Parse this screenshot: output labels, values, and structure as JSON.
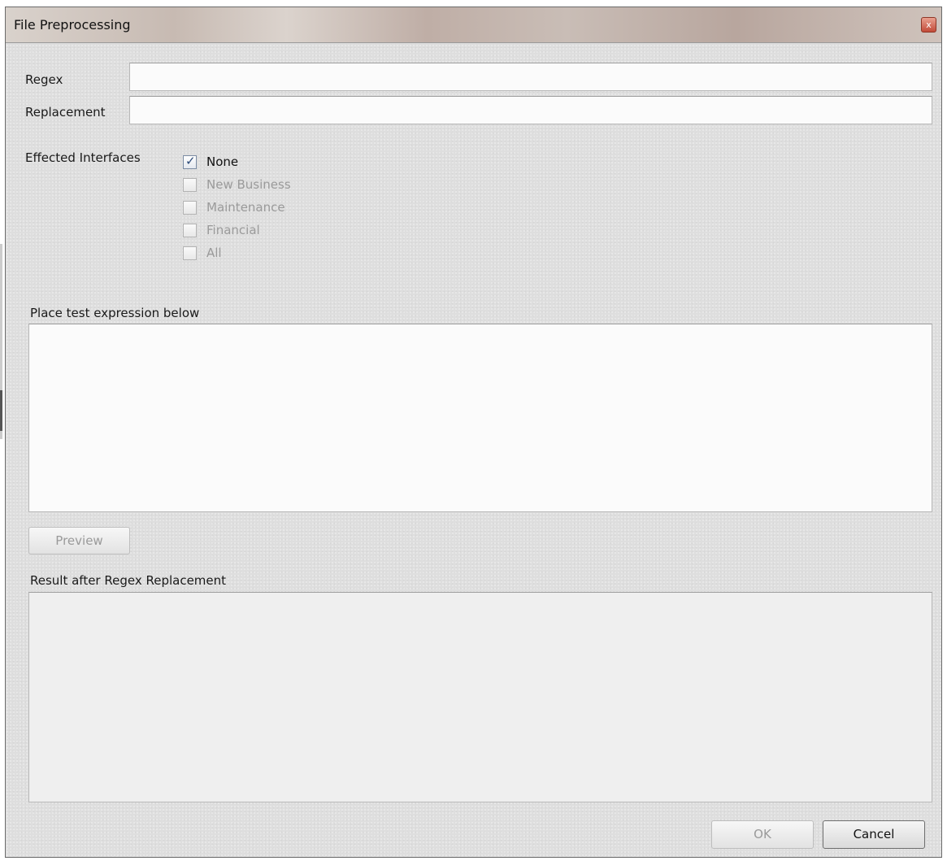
{
  "window": {
    "title": "File Preprocessing",
    "close_glyph": "x"
  },
  "form": {
    "regex_label": "Regex",
    "regex_value": "",
    "replacement_label": "Replacement",
    "replacement_value": ""
  },
  "interfaces": {
    "label": "Effected Interfaces",
    "options": [
      {
        "label": "None",
        "checked": true,
        "enabled": true
      },
      {
        "label": "New Business",
        "checked": false,
        "enabled": false
      },
      {
        "label": "Maintenance",
        "checked": false,
        "enabled": false
      },
      {
        "label": "Financial",
        "checked": false,
        "enabled": false
      },
      {
        "label": "All",
        "checked": false,
        "enabled": false
      }
    ]
  },
  "test": {
    "label": "Place test expression below",
    "value": ""
  },
  "preview_button": {
    "label": "Preview",
    "enabled": false
  },
  "result": {
    "label": "Result after Regex Replacement",
    "value": ""
  },
  "footer": {
    "ok_label": "OK",
    "ok_enabled": false,
    "cancel_label": "Cancel"
  }
}
